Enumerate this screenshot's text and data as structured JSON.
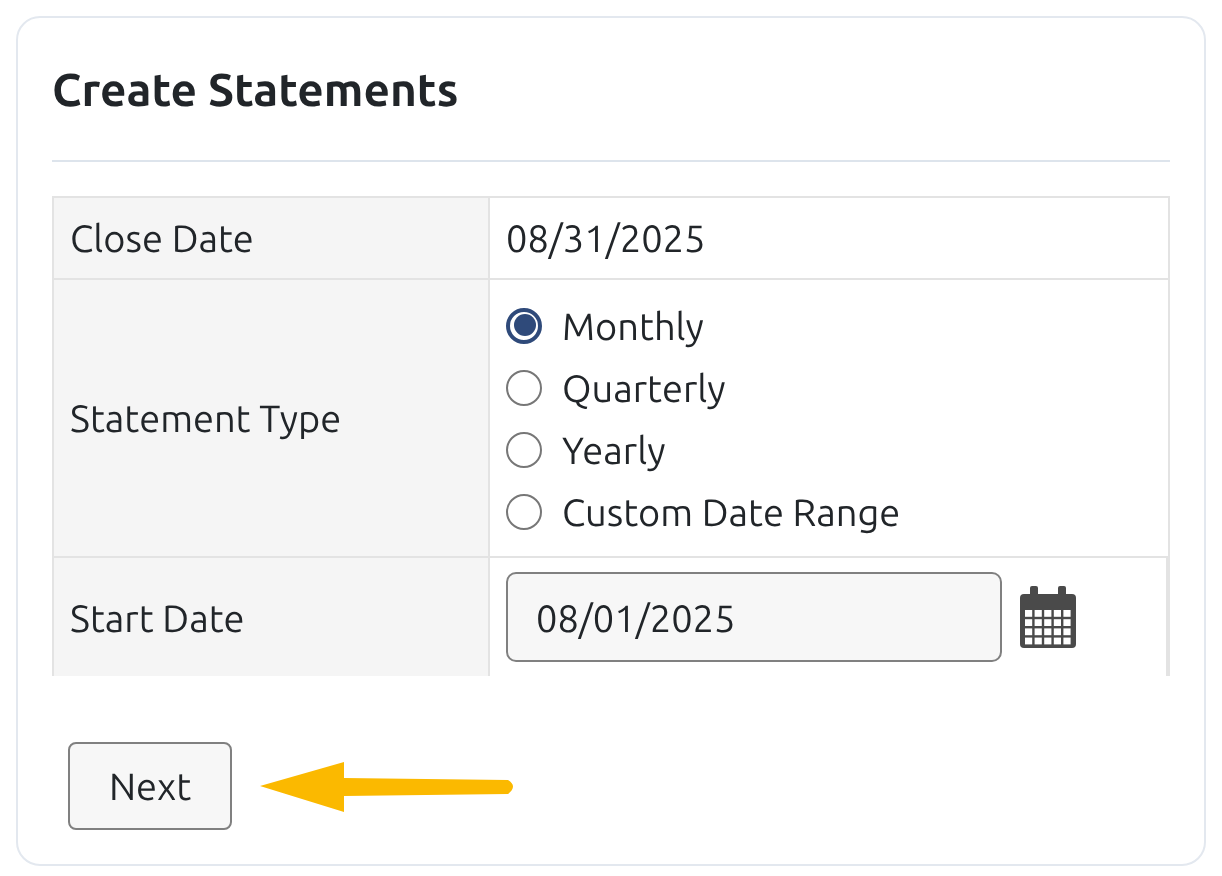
{
  "title": "Create Statements",
  "close_date": {
    "label": "Close Date",
    "value": "08/31/2025"
  },
  "statement_type": {
    "label": "Statement Type",
    "options": [
      {
        "label": "Monthly",
        "selected": true
      },
      {
        "label": "Quarterly",
        "selected": false
      },
      {
        "label": "Yearly",
        "selected": false
      },
      {
        "label": "Custom Date Range",
        "selected": false
      }
    ]
  },
  "start_date": {
    "label": "Start Date",
    "value": "08/01/2025"
  },
  "next_button": "Next"
}
